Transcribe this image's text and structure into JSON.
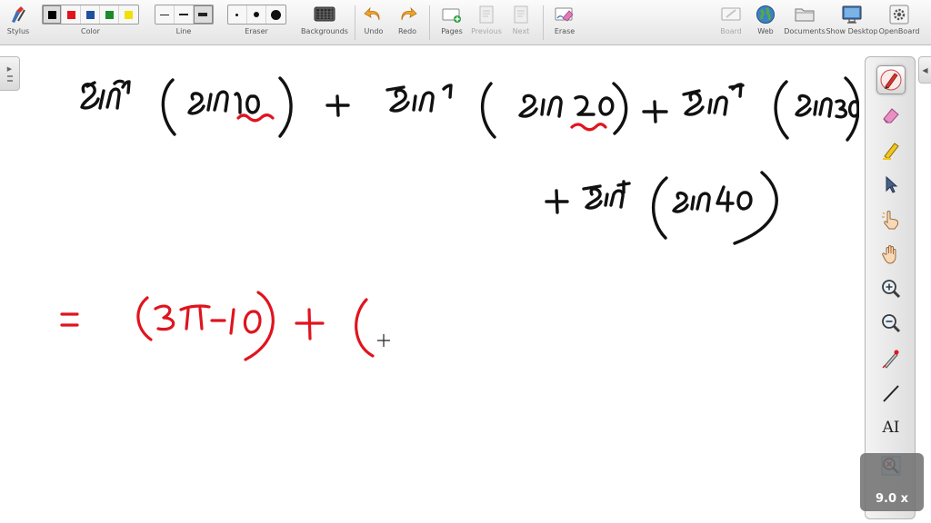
{
  "app": {
    "name": "OpenBoard"
  },
  "toolbar": {
    "stylus": "Stylus",
    "color": "Color",
    "line": "Line",
    "eraser": "Eraser",
    "backgrounds": "Backgrounds",
    "undo": "Undo",
    "redo": "Redo",
    "pages": "Pages",
    "previous": "Previous",
    "next": "Next",
    "erase": "Erase",
    "board": "Board",
    "web": "Web",
    "documents": "Documents",
    "show_desktop": "Show Desktop",
    "openboard": "OpenBoard",
    "colors": [
      "#000000",
      "#e0141e",
      "#1f4fa0",
      "#1d8a2a",
      "#f2e000"
    ],
    "selected_color_index": 0
  },
  "palette": {
    "tools": [
      "pen-icon",
      "eraser-icon",
      "marker-icon",
      "selector-icon",
      "play-icon",
      "hand-icon",
      "zoom-in-icon",
      "zoom-out-icon",
      "laser-pointer-icon",
      "line-icon",
      "text-icon",
      "capture-icon"
    ],
    "active_tool": "pen-icon",
    "text_tool_label": "AI"
  },
  "zoom": {
    "level": "9.0 x"
  },
  "ink_colors": {
    "black": "#111111",
    "red": "#e0141e"
  }
}
